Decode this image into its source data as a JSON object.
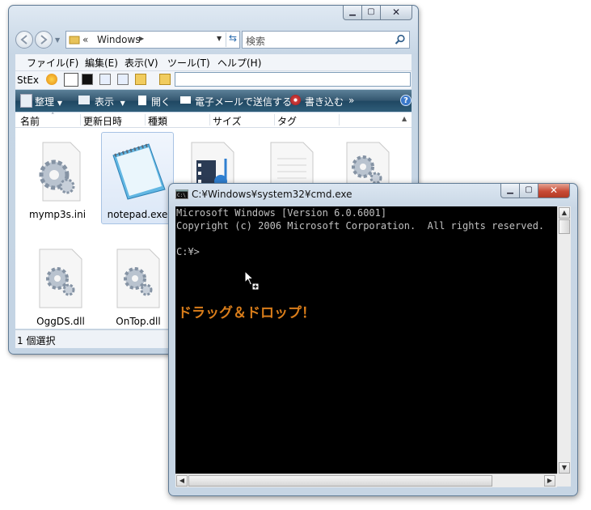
{
  "explorer": {
    "address_prefix": "«",
    "address": "Windows",
    "search_placeholder": "検索",
    "menu": [
      "ファイル(F)",
      "編集(E)",
      "表示(V)",
      "ツール(T)",
      "ヘルプ(H)"
    ],
    "stex_label": "StEx",
    "commands": {
      "organize": "整理",
      "view": "表示",
      "open": "開く",
      "email": "電子メールで送信する",
      "burn": "書き込む",
      "more": "»"
    },
    "columns": [
      "名前",
      "更新日時",
      "種類",
      "サイズ",
      "タグ"
    ],
    "files": [
      {
        "name": "mymp3s.ini",
        "icon": "ini-gear-icon",
        "selected": false
      },
      {
        "name": "notepad.exe",
        "icon": "notepad-icon",
        "selected": true
      },
      {
        "name": "",
        "icon": "media-file-icon",
        "selected": false
      },
      {
        "name": "",
        "icon": "text-file-icon",
        "selected": false
      },
      {
        "name": "",
        "icon": "gear-file-icon",
        "selected": false
      },
      {
        "name": "OggDS.dll",
        "icon": "dll-gear-icon",
        "selected": false
      },
      {
        "name": "OnTop.dll",
        "icon": "dll-gear-icon",
        "selected": false
      }
    ],
    "status": "1 個選択"
  },
  "cmd": {
    "title": "C:¥Windows¥system32¥cmd.exe",
    "lines": [
      "Microsoft Windows [Version 6.0.6001]",
      "Copyright (c) 2006 Microsoft Corporation.  All rights reserved.",
      "",
      "C:¥>"
    ]
  },
  "annotation": "ドラッグ＆ドロップ！",
  "colors": {
    "accent_orange": "#d97d1a",
    "command_bar": "#2f5d79",
    "console_bg": "#000000",
    "console_text": "#c0c0c0",
    "close_button": "#c84b36"
  }
}
